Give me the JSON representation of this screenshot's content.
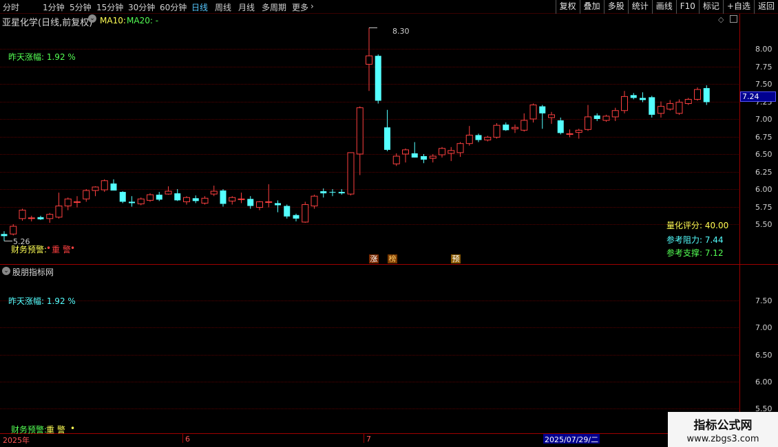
{
  "toolbar": {
    "periods": [
      "分时",
      "1分钟",
      "5分钟",
      "15分钟",
      "30分钟",
      "60分钟",
      "日线",
      "周线",
      "月线",
      "多周期",
      "更多"
    ],
    "active_period": "日线",
    "right_buttons": [
      "复权",
      "叠加",
      "多股",
      "统计",
      "画线",
      "F10",
      "标记",
      "+自选",
      "返回"
    ]
  },
  "main_panel": {
    "title": "亚星化学(日线,前复权)",
    "ma10_label": "MA10:",
    "ma20_label": "MA20: -",
    "yesterday_change": "昨天涨幅: 1.92 %",
    "high_label": "8.30",
    "low_label": "5.26",
    "current_price_tag": "7.24",
    "finance_warning_label": "财务预警:",
    "finance_warning_value": "重 警",
    "quant_score": "量化评分: 40.00",
    "resistance": "参考阻力: 7.44",
    "support": "参考支撑: 7.12",
    "event_tags": [
      "涨",
      "榜",
      "预"
    ],
    "colors": {
      "up": "#ff4040",
      "down": "#54ffff",
      "grid": "#5a0000",
      "warning_yellow": "#ffff54"
    }
  },
  "sub_panel": {
    "title": "股朋指标网",
    "yesterday_change": "昨天涨幅: 1.92 %",
    "finance_warning_label": "财务预警:",
    "finance_warning_value": "重 警"
  },
  "time_axis": {
    "labels": [
      "2025年",
      "6",
      "7"
    ],
    "cursor_date": "2025/07/29/二"
  },
  "watermark": {
    "title": "指标公式网",
    "url": "www.zbgs3.com"
  },
  "chart_data": {
    "type": "candlestick",
    "y_ticks_main": [
      "8.00",
      "7.75",
      "7.50",
      "7.25",
      "7.00",
      "6.75",
      "6.50",
      "6.25",
      "6.00",
      "5.75",
      "5.50"
    ],
    "y_ticks_sub": [
      "7.50",
      "7.00",
      "6.50",
      "6.00",
      "5.50"
    ],
    "candles": [
      {
        "o": 5.36,
        "h": 5.4,
        "l": 5.26,
        "c": 5.33
      },
      {
        "o": 5.36,
        "h": 5.5,
        "l": 5.34,
        "c": 5.47
      },
      {
        "o": 5.58,
        "h": 5.72,
        "l": 5.55,
        "c": 5.7
      },
      {
        "o": 5.59,
        "h": 5.62,
        "l": 5.54,
        "c": 5.59
      },
      {
        "o": 5.6,
        "h": 5.62,
        "l": 5.56,
        "c": 5.57
      },
      {
        "o": 5.58,
        "h": 5.66,
        "l": 5.52,
        "c": 5.64
      },
      {
        "o": 5.6,
        "h": 5.95,
        "l": 5.58,
        "c": 5.76
      },
      {
        "o": 5.76,
        "h": 5.88,
        "l": 5.7,
        "c": 5.86
      },
      {
        "o": 5.81,
        "h": 5.9,
        "l": 5.74,
        "c": 5.82
      },
      {
        "o": 5.86,
        "h": 6.0,
        "l": 5.82,
        "c": 5.98
      },
      {
        "o": 5.98,
        "h": 6.04,
        "l": 5.9,
        "c": 6.03
      },
      {
        "o": 5.99,
        "h": 6.14,
        "l": 5.96,
        "c": 6.12
      },
      {
        "o": 6.08,
        "h": 6.14,
        "l": 5.98,
        "c": 5.98
      },
      {
        "o": 5.96,
        "h": 5.97,
        "l": 5.8,
        "c": 5.82
      },
      {
        "o": 5.82,
        "h": 5.9,
        "l": 5.75,
        "c": 5.8
      },
      {
        "o": 5.79,
        "h": 5.88,
        "l": 5.77,
        "c": 5.86
      },
      {
        "o": 5.84,
        "h": 5.94,
        "l": 5.82,
        "c": 5.92
      },
      {
        "o": 5.92,
        "h": 5.96,
        "l": 5.83,
        "c": 5.85
      },
      {
        "o": 5.93,
        "h": 6.04,
        "l": 5.92,
        "c": 5.97
      },
      {
        "o": 5.94,
        "h": 6.0,
        "l": 5.83,
        "c": 5.84
      },
      {
        "o": 5.82,
        "h": 5.9,
        "l": 5.78,
        "c": 5.88
      },
      {
        "o": 5.87,
        "h": 5.91,
        "l": 5.8,
        "c": 5.83
      },
      {
        "o": 5.8,
        "h": 5.9,
        "l": 5.78,
        "c": 5.87
      },
      {
        "o": 5.93,
        "h": 6.05,
        "l": 5.9,
        "c": 5.97
      },
      {
        "o": 5.98,
        "h": 6.0,
        "l": 5.75,
        "c": 5.79
      },
      {
        "o": 5.83,
        "h": 5.9,
        "l": 5.78,
        "c": 5.88
      },
      {
        "o": 5.86,
        "h": 5.95,
        "l": 5.8,
        "c": 5.86
      },
      {
        "o": 5.86,
        "h": 5.9,
        "l": 5.72,
        "c": 5.76
      },
      {
        "o": 5.74,
        "h": 5.83,
        "l": 5.7,
        "c": 5.82
      },
      {
        "o": 5.82,
        "h": 6.07,
        "l": 5.74,
        "c": 5.82
      },
      {
        "o": 5.8,
        "h": 5.84,
        "l": 5.67,
        "c": 5.77
      },
      {
        "o": 5.76,
        "h": 5.78,
        "l": 5.58,
        "c": 5.61
      },
      {
        "o": 5.63,
        "h": 5.65,
        "l": 5.54,
        "c": 5.58
      },
      {
        "o": 5.53,
        "h": 5.82,
        "l": 5.52,
        "c": 5.78
      },
      {
        "o": 5.76,
        "h": 5.92,
        "l": 5.72,
        "c": 5.9
      },
      {
        "o": 5.97,
        "h": 6.01,
        "l": 5.88,
        "c": 5.94
      },
      {
        "o": 5.96,
        "h": 6.0,
        "l": 5.9,
        "c": 5.95
      },
      {
        "o": 5.96,
        "h": 6.0,
        "l": 5.92,
        "c": 5.94
      },
      {
        "o": 5.93,
        "h": 6.52,
        "l": 5.91,
        "c": 6.52
      },
      {
        "o": 6.5,
        "h": 7.18,
        "l": 6.2,
        "c": 7.16
      },
      {
        "o": 7.78,
        "h": 8.3,
        "l": 7.4,
        "c": 7.9
      },
      {
        "o": 7.9,
        "h": 7.92,
        "l": 7.22,
        "c": 7.26
      },
      {
        "o": 6.88,
        "h": 7.13,
        "l": 6.54,
        "c": 6.56
      },
      {
        "o": 6.36,
        "h": 6.51,
        "l": 6.33,
        "c": 6.47
      },
      {
        "o": 6.5,
        "h": 6.58,
        "l": 6.38,
        "c": 6.56
      },
      {
        "o": 6.51,
        "h": 6.67,
        "l": 6.45,
        "c": 6.45
      },
      {
        "o": 6.47,
        "h": 6.5,
        "l": 6.37,
        "c": 6.42
      },
      {
        "o": 6.44,
        "h": 6.5,
        "l": 6.38,
        "c": 6.47
      },
      {
        "o": 6.49,
        "h": 6.6,
        "l": 6.45,
        "c": 6.58
      },
      {
        "o": 6.51,
        "h": 6.6,
        "l": 6.4,
        "c": 6.55
      },
      {
        "o": 6.52,
        "h": 6.67,
        "l": 6.46,
        "c": 6.65
      },
      {
        "o": 6.65,
        "h": 6.9,
        "l": 6.62,
        "c": 6.77
      },
      {
        "o": 6.77,
        "h": 6.79,
        "l": 6.67,
        "c": 6.7
      },
      {
        "o": 6.7,
        "h": 6.76,
        "l": 6.68,
        "c": 6.74
      },
      {
        "o": 6.74,
        "h": 6.94,
        "l": 6.72,
        "c": 6.91
      },
      {
        "o": 6.92,
        "h": 6.95,
        "l": 6.83,
        "c": 6.84
      },
      {
        "o": 6.86,
        "h": 6.92,
        "l": 6.8,
        "c": 6.88
      },
      {
        "o": 6.84,
        "h": 7.08,
        "l": 6.82,
        "c": 6.98
      },
      {
        "o": 7.0,
        "h": 7.22,
        "l": 6.95,
        "c": 7.2
      },
      {
        "o": 7.18,
        "h": 7.2,
        "l": 6.86,
        "c": 7.08
      },
      {
        "o": 7.02,
        "h": 7.1,
        "l": 6.93,
        "c": 7.06
      },
      {
        "o": 6.98,
        "h": 7.02,
        "l": 6.78,
        "c": 6.8
      },
      {
        "o": 6.78,
        "h": 6.85,
        "l": 6.74,
        "c": 6.79
      },
      {
        "o": 6.81,
        "h": 6.86,
        "l": 6.72,
        "c": 6.84
      },
      {
        "o": 6.85,
        "h": 7.2,
        "l": 6.83,
        "c": 7.03
      },
      {
        "o": 7.05,
        "h": 7.08,
        "l": 6.97,
        "c": 7.0
      },
      {
        "o": 6.98,
        "h": 7.06,
        "l": 6.96,
        "c": 7.04
      },
      {
        "o": 7.03,
        "h": 7.16,
        "l": 6.97,
        "c": 7.12
      },
      {
        "o": 7.12,
        "h": 7.4,
        "l": 7.08,
        "c": 7.32
      },
      {
        "o": 7.34,
        "h": 7.37,
        "l": 7.28,
        "c": 7.3
      },
      {
        "o": 7.3,
        "h": 7.38,
        "l": 7.24,
        "c": 7.27
      },
      {
        "o": 7.31,
        "h": 7.33,
        "l": 7.02,
        "c": 7.06
      },
      {
        "o": 7.08,
        "h": 7.25,
        "l": 7.02,
        "c": 7.18
      },
      {
        "o": 7.14,
        "h": 7.27,
        "l": 7.12,
        "c": 7.22
      },
      {
        "o": 7.08,
        "h": 7.28,
        "l": 7.06,
        "c": 7.24
      },
      {
        "o": 7.22,
        "h": 7.3,
        "l": 7.2,
        "c": 7.28
      },
      {
        "o": 7.28,
        "h": 7.45,
        "l": 7.26,
        "c": 7.42
      },
      {
        "o": 7.44,
        "h": 7.48,
        "l": 7.2,
        "c": 7.24
      }
    ]
  }
}
